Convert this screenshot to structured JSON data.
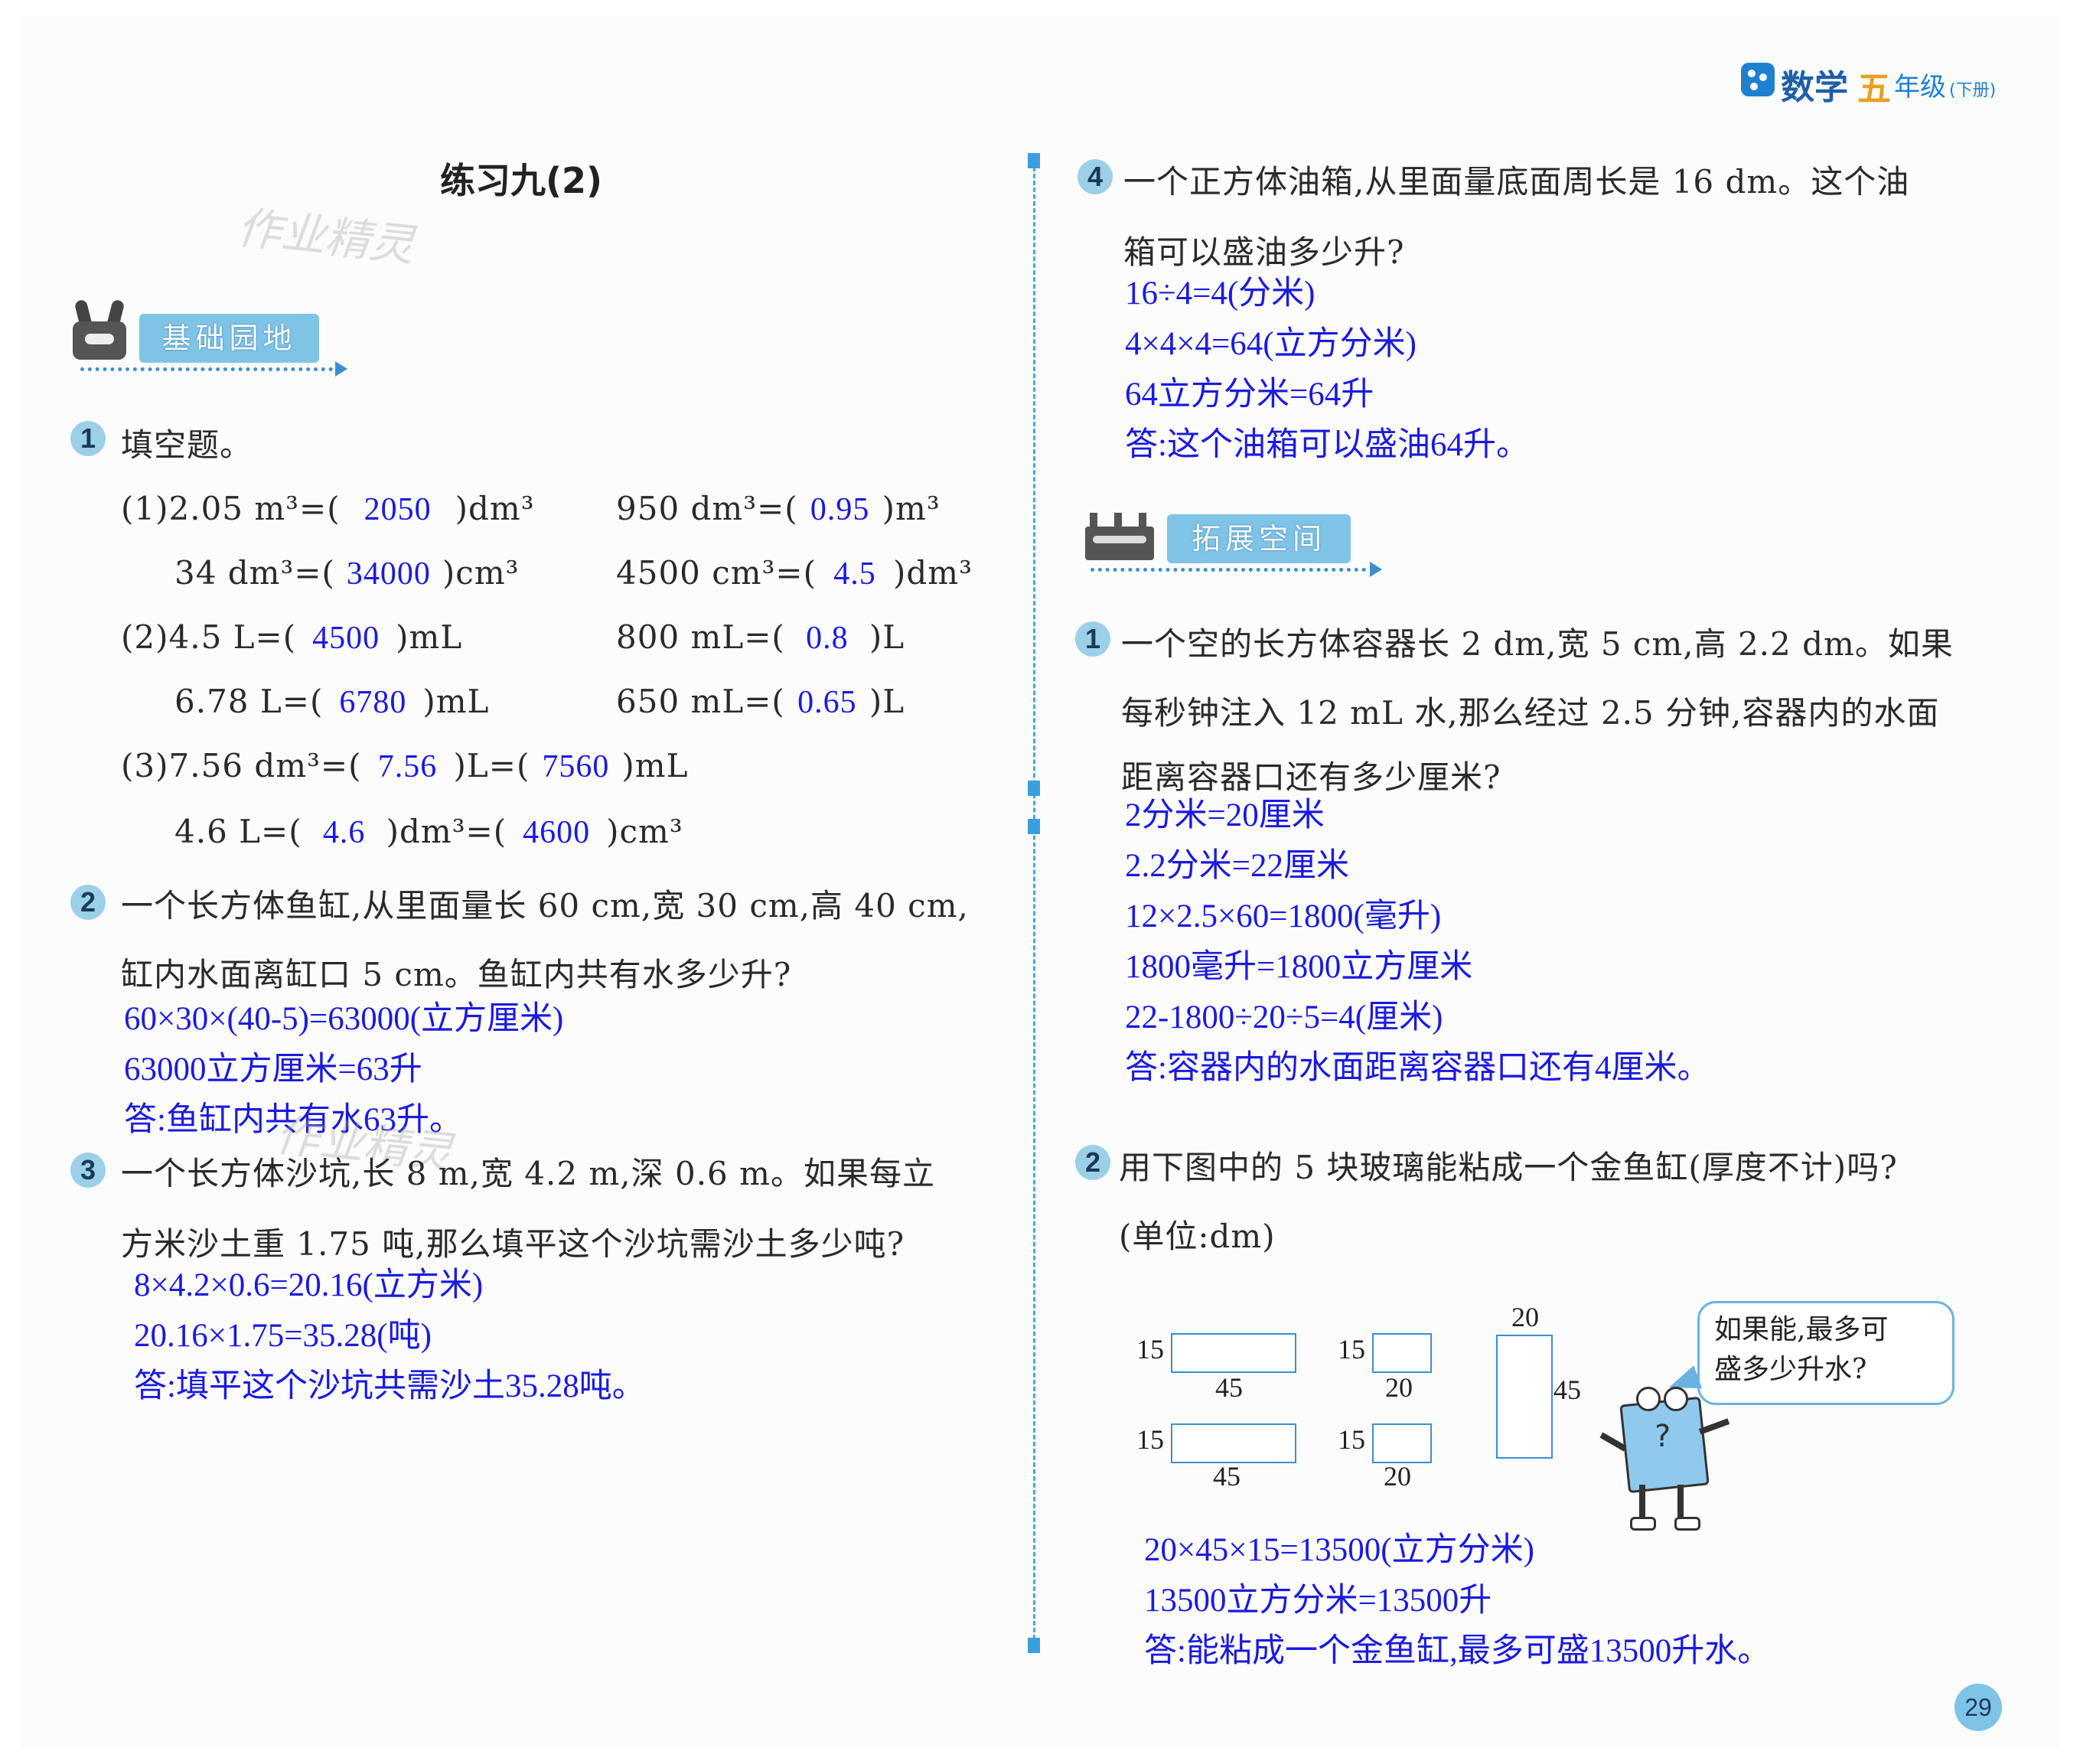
{
  "header": {
    "subject": "数学",
    "grade": "五",
    "grade_suffix": "年级",
    "volume": "(下册)"
  },
  "title": "练习九(2)",
  "watermark": "作业精灵",
  "sections": {
    "basic": "基础园地",
    "extend": "拓展空间"
  },
  "q1": {
    "num": "1",
    "text": "填空题。",
    "items": [
      {
        "pre": "(1)2.05 m³=(",
        "ans": "2050",
        "post": ")dm³"
      },
      {
        "pre": "950 dm³=(",
        "ans": "0.95",
        "post": ")m³"
      },
      {
        "pre": "34 dm³=(",
        "ans": "34000",
        "post": ")cm³"
      },
      {
        "pre": "4500 cm³=(",
        "ans": "4.5",
        "post": ")dm³"
      },
      {
        "pre": "(2)4.5 L=(",
        "ans": "4500",
        "post": ")mL"
      },
      {
        "pre": "800 mL=(",
        "ans": "0.8",
        "post": ")L"
      },
      {
        "pre": "6.78 L=(",
        "ans": "6780",
        "post": ")mL"
      },
      {
        "pre": "650 mL=(",
        "ans": "0.65",
        "post": ")L"
      },
      {
        "pre": "(3)7.56 dm³=(",
        "ans": "7.56",
        "mid": ")L=(",
        "ans2": "7560",
        "post": ")mL"
      },
      {
        "pre": "4.6 L=(",
        "ans": "4.6",
        "mid": ")dm³=(",
        "ans2": "4600",
        "post": ")cm³"
      }
    ]
  },
  "q2": {
    "num": "2",
    "line1": "一个长方体鱼缸,从里面量长 60 cm,宽 30 cm,高 40 cm,",
    "line2": "缸内水面离缸口 5 cm。鱼缸内共有水多少升?",
    "answers": [
      "60×30×(40-5)=63000(立方厘米)",
      "63000立方厘米=63升",
      "答:鱼缸内共有水63升。"
    ]
  },
  "q3": {
    "num": "3",
    "line1": "一个长方体沙坑,长 8 m,宽 4.2 m,深 0.6 m。如果每立",
    "line2": "方米沙土重 1.75 吨,那么填平这个沙坑需沙土多少吨?",
    "answers": [
      "8×4.2×0.6=20.16(立方米)",
      "20.16×1.75=35.28(吨)",
      "答:填平这个沙坑共需沙土35.28吨。"
    ]
  },
  "q4": {
    "num": "4",
    "line1": "一个正方体油箱,从里面量底面周长是 16 dm。这个油",
    "line2": "箱可以盛油多少升?",
    "answers": [
      "16÷4=4(分米)",
      "4×4×4=64(立方分米)",
      "64立方分米=64升",
      "答:这个油箱可以盛油64升。"
    ]
  },
  "e1": {
    "num": "1",
    "line1": "一个空的长方体容器长 2 dm,宽 5 cm,高 2.2 dm。如果",
    "line2": "每秒钟注入 12 mL 水,那么经过 2.5 分钟,容器内的水面",
    "line3": "距离容器口还有多少厘米?",
    "answers": [
      "2分米=20厘米",
      "2.2分米=22厘米",
      "12×2.5×60=1800(毫升)",
      "1800毫升=1800立方厘米",
      "22-1800÷20÷5=4(厘米)",
      "答:容器内的水面距离容器口还有4厘米。"
    ]
  },
  "e2": {
    "num": "2",
    "line1": "用下图中的 5 块玻璃能粘成一个金鱼缸(厚度不计)吗?",
    "line2": "(单位:dm)",
    "diagram": {
      "labels": [
        "15",
        "45",
        "15",
        "20",
        "20",
        "45",
        "15",
        "45",
        "15",
        "20"
      ]
    },
    "bubble": [
      "如果能,最多可",
      "盛多少升水?"
    ],
    "answers": [
      "20×45×15=13500(立方分米)",
      "13500立方分米=13500升",
      "答:能粘成一个金鱼缸,最多可盛13500升水。"
    ]
  },
  "page_number": "29",
  "colors": {
    "answer": "#1a1adf",
    "accent": "#7fc3e6",
    "badge": "#9ccfe8"
  }
}
